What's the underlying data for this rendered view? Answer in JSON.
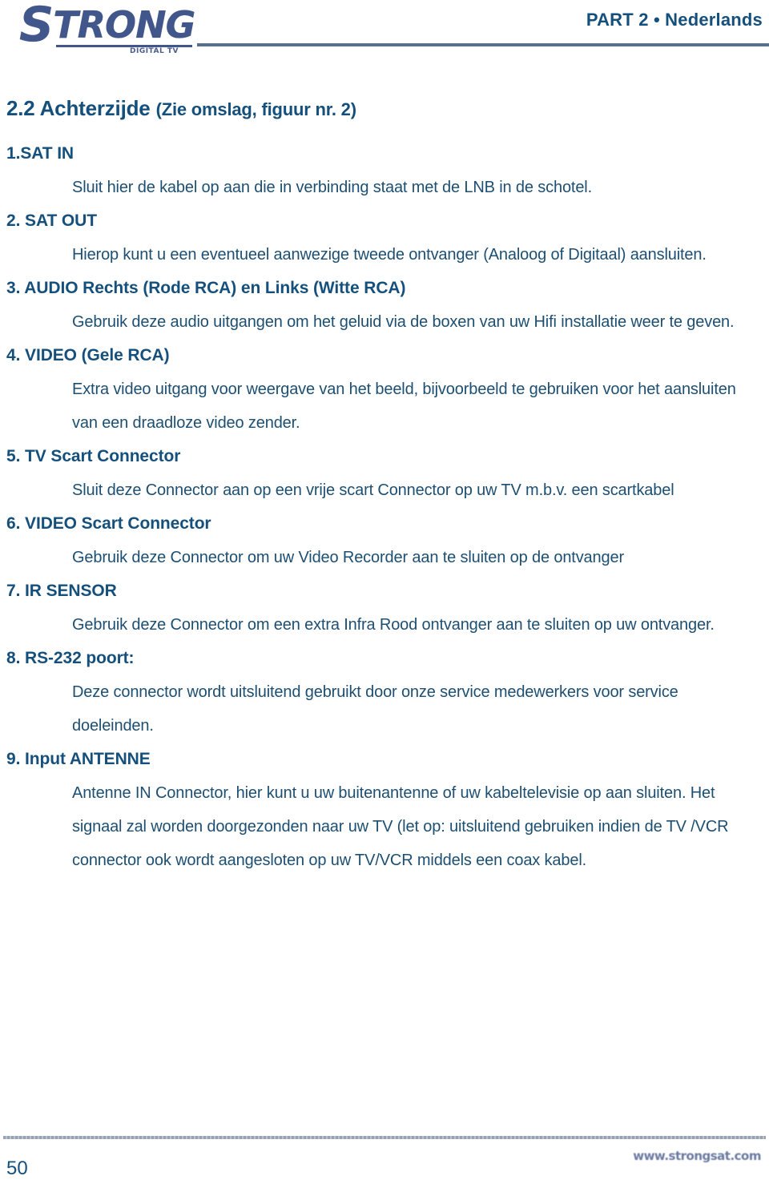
{
  "header": {
    "logo_wordmark_lead": "S",
    "logo_wordmark_rest": "TRONG",
    "logo_subtitle": "DIGITAL TV",
    "title": "PART 2 • Nederlands"
  },
  "section": {
    "number_and_name": "2.2 Achterzijde ",
    "parenthetical": "(Zie omslag, figuur nr. 2)"
  },
  "items": [
    {
      "heading": "1.SAT IN",
      "body": "Sluit hier de kabel op aan die in verbinding staat met de LNB in de schotel."
    },
    {
      "heading": "2. SAT OUT",
      "body": "Hierop kunt u een eventueel aanwezige tweede ontvanger (Analoog of Digitaal) aansluiten."
    },
    {
      "heading": "3. AUDIO Rechts (Rode RCA) en Links (Witte RCA)",
      "body": "Gebruik deze audio uitgangen om het geluid via de boxen van uw Hifi installatie weer te geven."
    },
    {
      "heading": "4.  VIDEO (Gele RCA)",
      "body": "Extra video uitgang voor weergave van het beeld, bijvoorbeeld te gebruiken voor het aansluiten van een draadloze video zender."
    },
    {
      "heading": "5. TV Scart Connector",
      "body": "Sluit deze Connector aan op een vrije scart Connector op uw TV m.b.v. een scartkabel"
    },
    {
      "heading": "6. VIDEO Scart Connector",
      "body": "Gebruik deze Connector om uw Video Recorder aan te sluiten op de ontvanger"
    },
    {
      "heading": "7. IR SENSOR",
      "body": "Gebruik deze Connector om een extra Infra Rood ontvanger aan te sluiten op uw ontvanger."
    },
    {
      "heading": "8. RS-232 poort:",
      "body": "Deze connector wordt uitsluitend gebruikt door onze service medewerkers voor service doeleinden."
    },
    {
      "heading": "9. Input ANTENNE",
      "body": "Antenne IN Connector, hier kunt u uw buitenantenne of uw kabeltelevisie op aan sluiten. Het signaal zal worden doorgezonden naar uw TV (let op: uitsluitend gebruiken indien de TV /VCR connector ook wordt aangesloten op uw TV/VCR middels een coax kabel."
    }
  ],
  "footer": {
    "page_number": "50",
    "url": "www.strongsat.com"
  },
  "colors": {
    "heading_blue": "#15507d",
    "body_blue": "#1d4f72",
    "logo_blue": "#41568a",
    "rule_gray": "#5a6f8d",
    "footer_rule": "#97a2b3"
  }
}
